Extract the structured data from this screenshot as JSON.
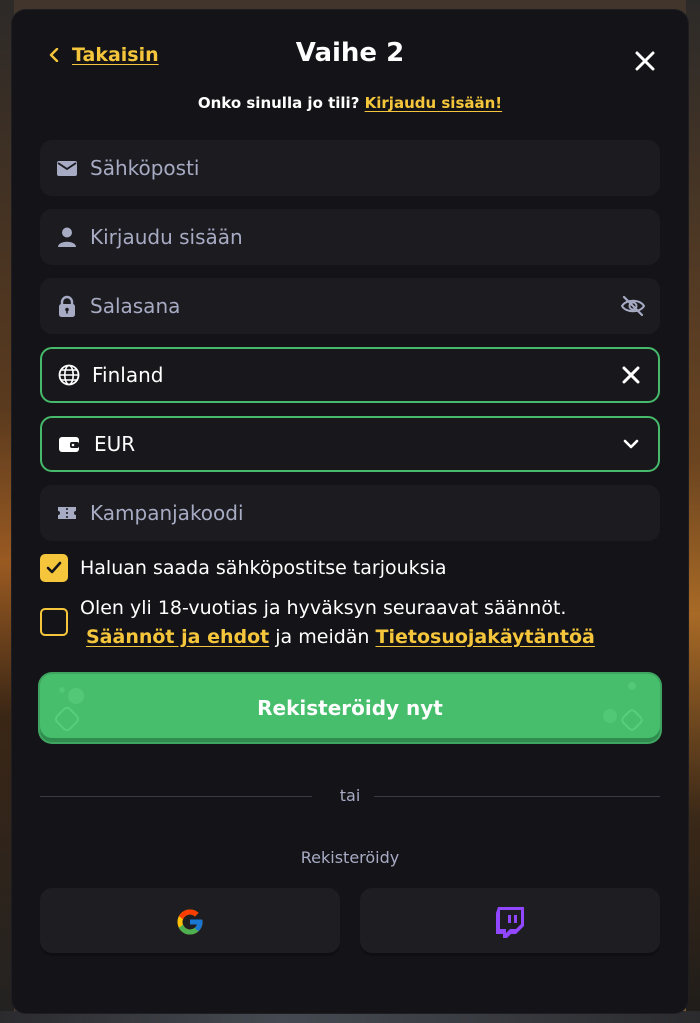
{
  "header": {
    "back_label": "Takaisin",
    "title": "Vaihe 2"
  },
  "login_prompt": {
    "text": "Onko sinulla jo tili?",
    "link": "Kirjaudu sisään!"
  },
  "fields": {
    "email_placeholder": "Sähköposti",
    "username_placeholder": "Kirjaudu sisään",
    "password_placeholder": "Salasana",
    "country_value": "Finland",
    "currency_value": "EUR",
    "promo_placeholder": "Kampanjakoodi"
  },
  "consents": {
    "offers_label": "Haluan saada sähköpostitse tarjouksia",
    "offers_checked": true,
    "age_text": "Olen yli 18-vuotias ja hyväksyn seuraavat säännöt.",
    "terms_link": "Säännöt ja ehdot",
    "and_text": "ja meidän",
    "privacy_link": "Tietosuojakäytäntöä",
    "age_checked": false
  },
  "register_button": "Rekisteröidy nyt",
  "divider_text": "tai",
  "social": {
    "label": "Rekisteröidy",
    "providers": [
      "google",
      "twitch"
    ]
  },
  "colors": {
    "accent_yellow": "#f5c63b",
    "accent_green": "#46be6c",
    "modal_bg": "#141418",
    "field_bg": "#1b1b20",
    "placeholder": "#a7abc3",
    "twitch": "#9146ff"
  }
}
